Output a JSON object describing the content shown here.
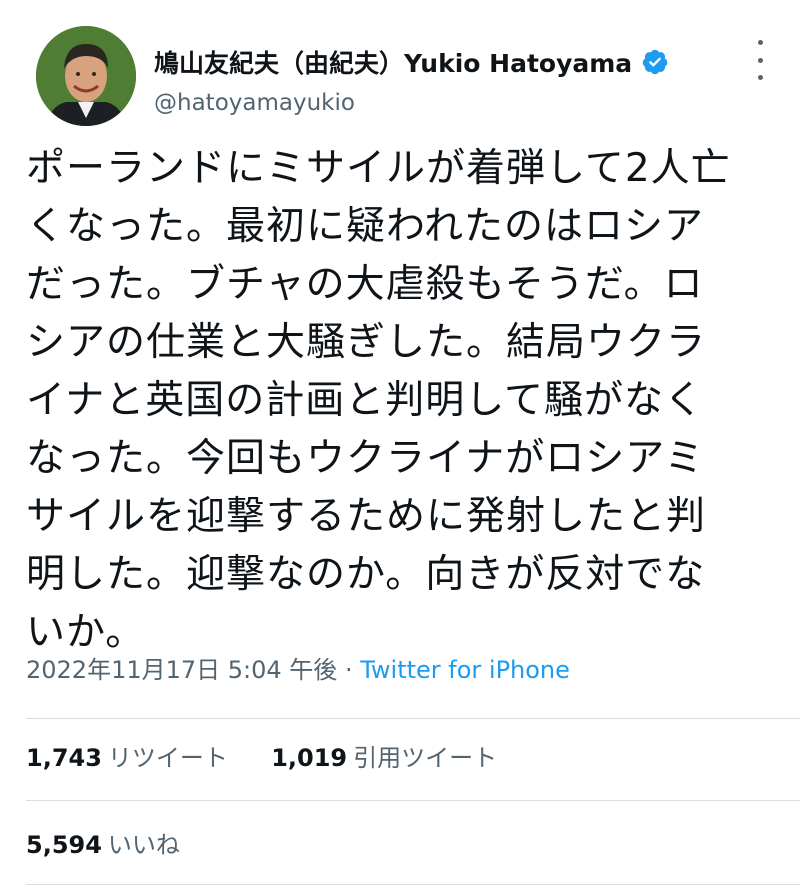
{
  "tweet": {
    "author": {
      "display_name": "鳩山友紀夫（由紀夫）Yukio Hatoyama",
      "handle": "@hatoyamayukio",
      "verified": true,
      "avatar_icon": "user-avatar-photo"
    },
    "text_lines": [
      "ポーランドにミサイルが着弾して2人亡",
      "くなった。最初に疑われたのはロシア",
      "だった。ブチャの大虐殺もそうだ。ロ",
      "シアの仕業と大騒ぎした。結局ウクラ",
      "イナと英国の計画と判明して騒がなく",
      "なった。今回もウクライナがロシアミ",
      "サイルを迎撃するために発射したと判",
      "明した。迎撃なのか。向きが反対でな",
      "いか。"
    ],
    "timestamp": "2022年11月17日 5:04 午後",
    "separator": " · ",
    "source": "Twitter for iPhone",
    "stats": {
      "retweets_count": "1,743",
      "retweets_label": "リツイート",
      "quotes_count": "1,019",
      "quotes_label": "引用ツイート",
      "likes_count": "5,594",
      "likes_label": "いいね"
    }
  },
  "colors": {
    "text_primary": "#0f1419",
    "text_secondary": "#536471",
    "link": "#1d9bf0",
    "verified_badge": "#1d9bf0",
    "divider": "#d8dde1"
  },
  "icons": {
    "verified": "verified-badge-icon",
    "more": "more-options-icon"
  }
}
